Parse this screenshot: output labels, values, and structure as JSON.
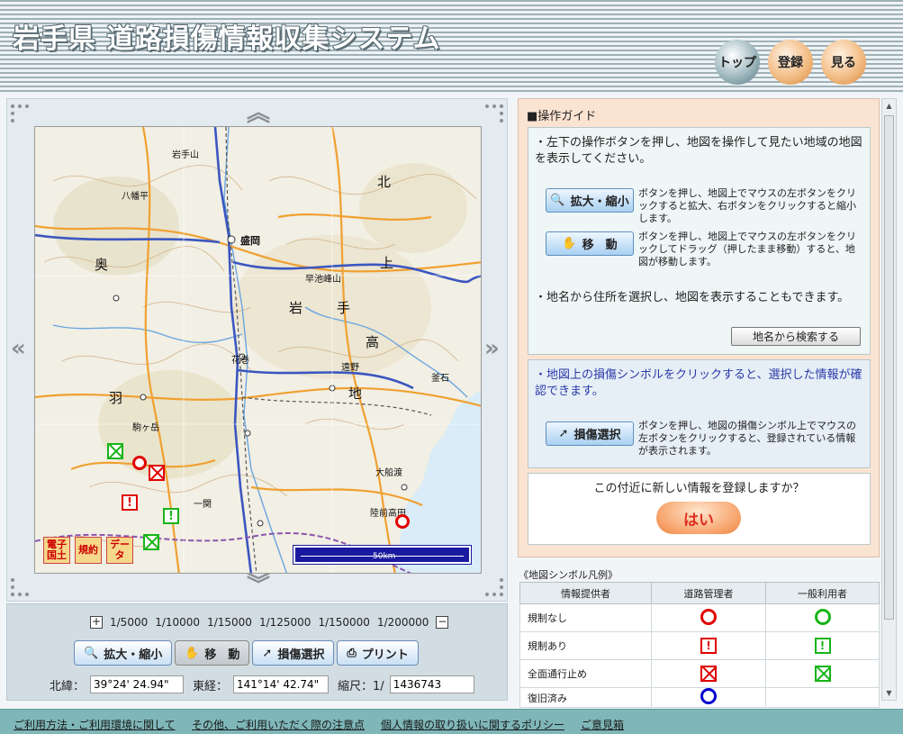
{
  "header": {
    "title": "岩手県 道路損傷情報収集システム",
    "nav": {
      "top": "トップ",
      "register": "登録",
      "view": "見る"
    }
  },
  "map": {
    "place_labels": [
      "岩手山",
      "盛岡",
      "八幡平",
      "岩",
      "手",
      "北",
      "上",
      "高",
      "地",
      "羽",
      "奥",
      "駒ヶ岳",
      "早池峰山",
      "大船渡",
      "陸前高田",
      "一関",
      "花巻",
      "遠野",
      "釜石"
    ],
    "mini_buttons": {
      "denshi": "電子国土",
      "kiyaku": "規約",
      "data": "データ"
    },
    "scale_label": "50km"
  },
  "controls": {
    "zoom_scales": [
      "1/5000",
      "1/10000",
      "1/15000",
      "1/125000",
      "1/150000",
      "1/200000"
    ],
    "buttons": {
      "zoom": "拡大・縮小",
      "move": "移　動",
      "damage": "損傷選択",
      "print": "プリント"
    },
    "lat_label": "北緯：",
    "lat_value": "39°24' 24.94\"",
    "lon_label": "東経：",
    "lon_value": "141°14' 42.74\"",
    "scale_label": "縮尺：1/",
    "scale_value": "1436743"
  },
  "guide": {
    "heading": "■操作ガイド",
    "intro": "・左下の操作ボタンを押し、地図を操作して見たい地域の地図を表示してください。",
    "zoom_button": "拡大・縮小",
    "zoom_desc": "ボタンを押し、地図上でマウスの左ボタンをクリックすると拡大、右ボタンをクリックすると縮小します。",
    "move_button": "移　動",
    "move_desc": "ボタンを押し、地図上でマウスの左ボタンをクリックしてドラッグ（押したまま移動）すると、地図が移動します。",
    "place_text": "・地名から住所を選択し、地図を表示することもできます。",
    "search_button": "地名から検索する",
    "damage_text": "・地図上の損傷シンボルをクリックすると、選択した情報が確認できます。",
    "damage_button": "損傷選択",
    "damage_desc": "ボタンを押し、地図の損傷シンボル上でマウスの左ボタンをクリックすると、登録されている情報が表示されます。",
    "register_question": "この付近に新しい情報を登録しますか？",
    "yes_button": "はい"
  },
  "legend": {
    "title": "《地図シンボル凡例》",
    "headers": [
      "情報提供者",
      "道路管理者",
      "一般利用者"
    ],
    "rows": [
      "規制なし",
      "規制あり",
      "全面通行止め",
      "復旧済み"
    ],
    "colors": {
      "admin": "#e00000",
      "user": "#18b418",
      "restored": "#0000cc"
    }
  },
  "footer": {
    "links": [
      "ご利用方法・ご利用環境に関して",
      "その他、ご利用いただく際の注意点",
      "個人情報の取り扱いに関するポリシー",
      "ご意見箱"
    ]
  }
}
